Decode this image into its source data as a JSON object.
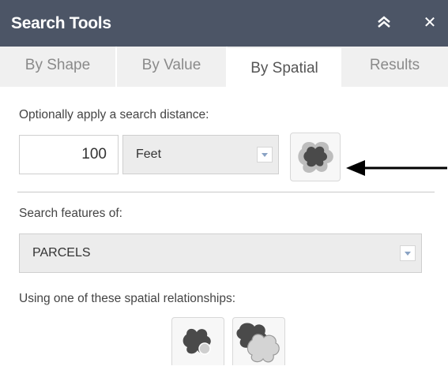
{
  "panel": {
    "title": "Search Tools",
    "collapse_icon": "double-chevron-up-icon",
    "close_icon": "close-icon",
    "close_glyph": "✕"
  },
  "tabs": [
    {
      "label": "By Shape",
      "active": false
    },
    {
      "label": "By Value",
      "active": false
    },
    {
      "label": "By Spatial",
      "active": true
    },
    {
      "label": "Results",
      "active": false
    }
  ],
  "distance": {
    "label": "Optionally apply a search distance:",
    "value": "100",
    "unit": "Feet",
    "buffer_icon": "buffer-shape-icon"
  },
  "features": {
    "label": "Search features of:",
    "layer": "PARCELS"
  },
  "relationships": {
    "label": "Using one of these spatial relationships:",
    "icons": [
      "contains-centroid-icon",
      "intersects-icon"
    ]
  },
  "colors": {
    "header_bg": "#4c5566",
    "tab_bg": "#f0f0f0",
    "arrow": "#000000"
  }
}
